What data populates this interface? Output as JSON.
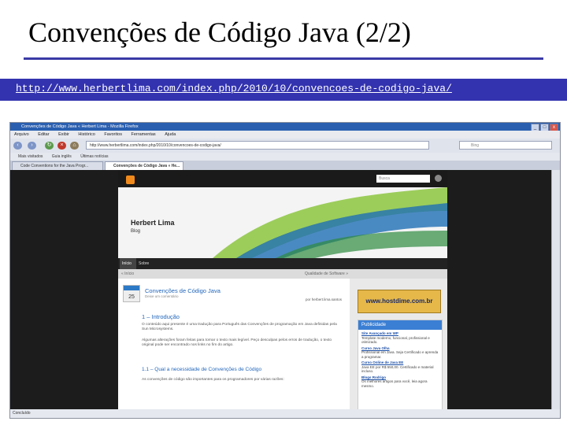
{
  "slide": {
    "title": "Convenções de Código Java (2/2)",
    "url": "http://www.herbertlima.com/index.php/2010/10/convencoes-de-codigo-java/"
  },
  "browser": {
    "window_title": "Convenções de Código Java « Herbert Lima - Mozilla Firefox",
    "menu": [
      "Arquivo",
      "Editar",
      "Exibir",
      "Histórico",
      "Favoritos",
      "Ferramentas",
      "Ajuda"
    ],
    "address": "http://www.herbertlima.com/index.php/2010/10/convencoes-de-codigo-java/",
    "search_placeholder": "Bing",
    "bookmarks": [
      "Mais visitados",
      "Guia inglês",
      "Últimas notícias"
    ],
    "tabs": [
      "Code Conventions for the Java Progr...",
      "Convenções de Código Java « He..."
    ],
    "status": "Concluído"
  },
  "blog": {
    "search_placeholder": "Busca",
    "name": "Herbert Lima",
    "subtitle": "Blog",
    "nav": [
      "Início",
      "Sobre"
    ],
    "breadcrumb_left": "« Início",
    "breadcrumb_right": "Qualidade de Software »",
    "post": {
      "date_day": "25",
      "title": "Convenções de Código Java",
      "author_line": "Deixe um comentário",
      "by_line": "por herbert.lima.santos",
      "intro_heading": "1 – Introdução",
      "intro_text": "O conteúdo aqui presente é uma tradução para Português das Convenções de programação em Java definidas pela Sun Microsystems.",
      "note_text": "Algumas alterações foram feitas para tornar o texto mais legível. Peço desculpas pelos erros de tradução, o texto original pode ser encontrado nos links no fim do artigo.",
      "question_heading": "1.1 – Qual a necessidade de Convenções de Código",
      "question_text": "As convenções de código são importantes para os programadores por várias razões:"
    },
    "sidebar": {
      "ad_banner": "www.hostdime.com.br",
      "heading": "Publicidade",
      "ads": [
        {
          "title": "Site Avançado em WP",
          "text": "Template moderno, funcional, profissional e otimizado."
        },
        {
          "title": "Curso Java Olha",
          "text": "Profissional em Java. Seja Certificado e aprenda a programar."
        },
        {
          "title": "Curso Online de Java EE",
          "text": "Java EE por R$ 550,00. Certificado e material incluso."
        },
        {
          "title": "Blogs Rodrigo",
          "text": "Os melhores artigos para você, leia agora mesmo."
        }
      ]
    }
  }
}
